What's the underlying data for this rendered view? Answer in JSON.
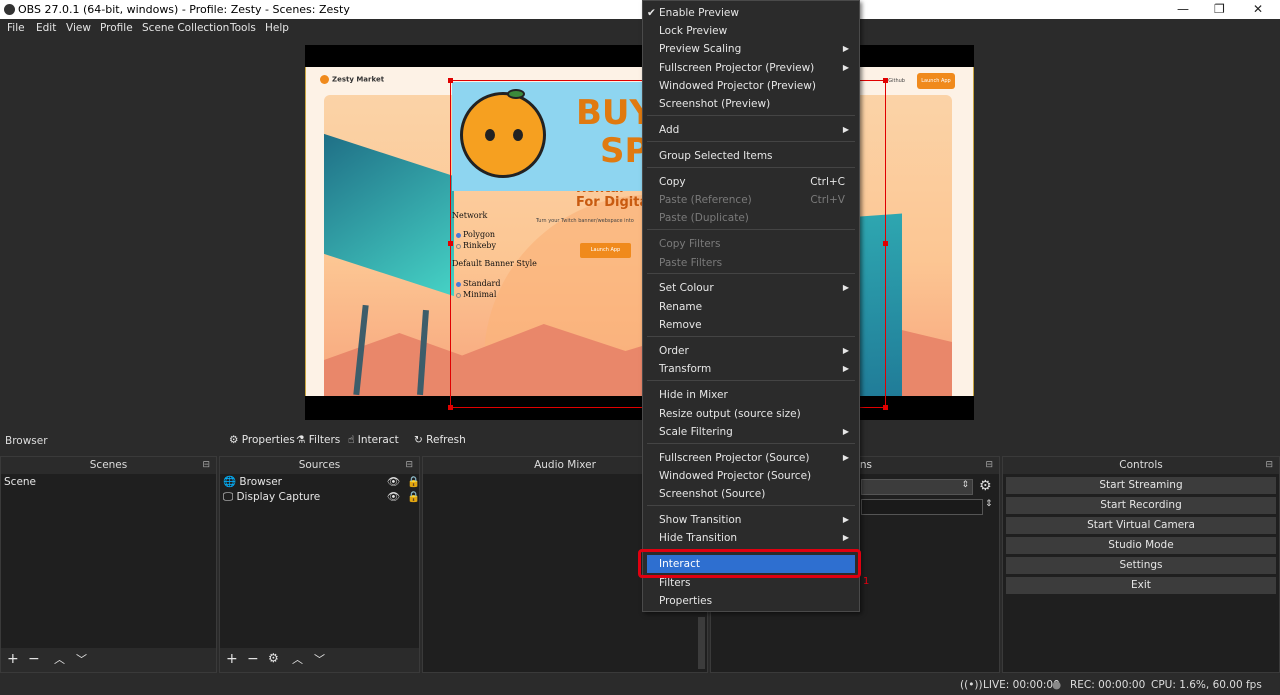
{
  "titlebar": {
    "title": "OBS 27.0.1 (64-bit, windows) - Profile: Zesty - Scenes: Zesty",
    "minimize": "—",
    "maximize": "❐",
    "close": "✕"
  },
  "menubar": {
    "items": [
      "File",
      "Edit",
      "View",
      "Profile",
      "Scene Collection",
      "Tools",
      "Help"
    ]
  },
  "preview": {
    "brand": "Zesty Market",
    "github": "Github",
    "launch_top": "Launch App",
    "headline": "BUY\nSPA",
    "sub1": "Rental",
    "sub2": "For Digita",
    "tagline": "Turn your Twitch banner/webspace into",
    "launch_mid": "Launch App",
    "network_label": "Network",
    "net1": "Polygon",
    "net2": "Rinkeby",
    "style_label": "Default Banner Style",
    "style1": "Standard",
    "style2": "Minimal"
  },
  "toolbar": {
    "source": "Browser",
    "properties": "Properties",
    "filters": "Filters",
    "interact": "Interact",
    "refresh": "Refresh"
  },
  "docks": {
    "scenes": {
      "title": "Scenes",
      "items": [
        "Scene"
      ]
    },
    "sources": {
      "title": "Sources",
      "items": [
        "Browser",
        "Display Capture"
      ]
    },
    "mixer": {
      "title": "Audio Mixer"
    },
    "transitions": {
      "title": "sitions"
    },
    "controls": {
      "title": "Controls",
      "buttons": [
        "Start Streaming",
        "Start Recording",
        "Start Virtual Camera",
        "Studio Mode",
        "Settings",
        "Exit"
      ]
    }
  },
  "statusbar": {
    "live": "LIVE: 00:00:00",
    "rec": "REC: 00:00:00",
    "cpu": "CPU: 1.6%, 60.00 fps"
  },
  "context_menu": {
    "items": [
      {
        "label": "Enable Preview",
        "checked": true
      },
      {
        "label": "Lock Preview"
      },
      {
        "label": "Preview Scaling",
        "submenu": true
      },
      {
        "label": "Fullscreen Projector (Preview)",
        "submenu": true
      },
      {
        "label": "Windowed Projector (Preview)"
      },
      {
        "label": "Screenshot (Preview)"
      },
      {
        "label": "Add",
        "submenu": true
      },
      {
        "label": "Group Selected Items"
      },
      {
        "label": "Copy",
        "shortcut": "Ctrl+C"
      },
      {
        "label": "Paste (Reference)",
        "shortcut": "Ctrl+V",
        "disabled": true
      },
      {
        "label": "Paste (Duplicate)",
        "disabled": true
      },
      {
        "label": "Copy Filters",
        "disabled": true
      },
      {
        "label": "Paste Filters",
        "disabled": true
      },
      {
        "label": "Set Colour",
        "submenu": true
      },
      {
        "label": "Rename"
      },
      {
        "label": "Remove"
      },
      {
        "label": "Order",
        "submenu": true
      },
      {
        "label": "Transform",
        "submenu": true
      },
      {
        "label": "Hide in Mixer"
      },
      {
        "label": "Resize output (source size)"
      },
      {
        "label": "Scale Filtering",
        "submenu": true
      },
      {
        "label": "Fullscreen Projector (Source)",
        "submenu": true
      },
      {
        "label": "Windowed Projector (Source)"
      },
      {
        "label": "Screenshot (Source)"
      },
      {
        "label": "Show Transition",
        "submenu": true
      },
      {
        "label": "Hide Transition",
        "submenu": true
      },
      {
        "label": "Interact",
        "highlighted": true
      },
      {
        "label": "Filters"
      },
      {
        "label": "Properties"
      }
    ]
  },
  "annotation": {
    "label": "1"
  }
}
